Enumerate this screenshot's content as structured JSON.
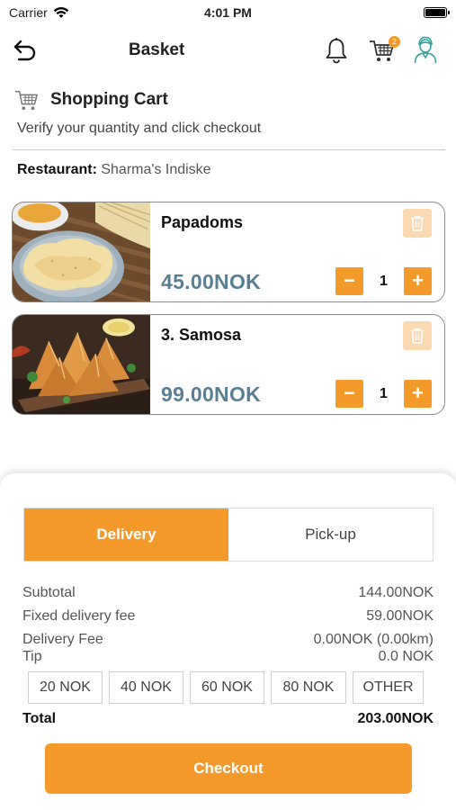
{
  "status_bar": {
    "carrier": "Carrier",
    "time": "4:01 PM"
  },
  "nav": {
    "title": "Basket",
    "cart_badge": "2"
  },
  "cart": {
    "title": "Shopping Cart",
    "subtitle": "Verify your quantity and click checkout",
    "restaurant_label": "Restaurant:",
    "restaurant_name": "Sharma's Indiske"
  },
  "items": [
    {
      "name": "Papadoms",
      "price": "45.00NOK",
      "quantity": "1",
      "image": "papadoms-photo"
    },
    {
      "name": "3. Samosa",
      "price": "99.00NOK",
      "quantity": "1",
      "image": "samosa-photo"
    }
  ],
  "qty_controls": {
    "minus": "−",
    "plus": "+"
  },
  "order_type": {
    "tabs": [
      "Delivery",
      "Pick-up"
    ],
    "selected": "Delivery"
  },
  "summary": {
    "subtotal_label": "Subtotal",
    "subtotal_value": "144.00NOK",
    "fixed_fee_label": "Fixed delivery fee",
    "fixed_fee_value": "59.00NOK",
    "delivery_fee_label": "Delivery Fee",
    "delivery_fee_value": "0.00NOK (0.00km)",
    "tip_label": "Tip",
    "tip_value": "0.0 NOK",
    "total_label": "Total",
    "total_value": "203.00NOK"
  },
  "tip_options": [
    "20 NOK",
    "40 NOK",
    "60 NOK",
    "80 NOK",
    "OTHER"
  ],
  "checkout_label": "Checkout",
  "colors": {
    "accent": "#f49a2a",
    "price": "#5a7f93",
    "delete_bg": "#fbd9b2"
  }
}
